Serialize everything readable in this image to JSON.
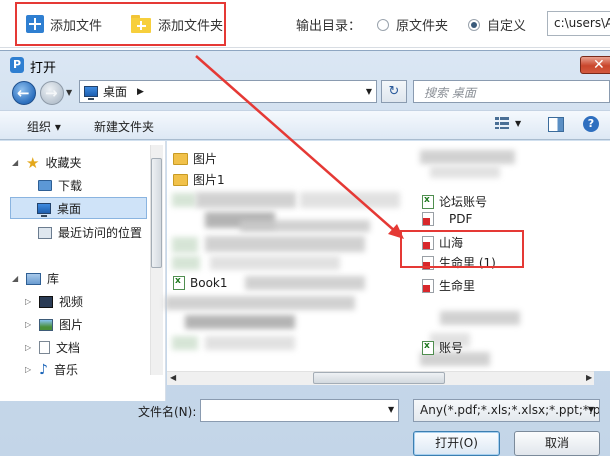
{
  "app_toolbar": {
    "add_file": "添加文件",
    "add_folder": "添加文件夹",
    "output_dir_label": "输出目录：",
    "radio_original": "原文件夹",
    "radio_custom": "自定义",
    "selected_radio": "自定义",
    "path_value": "c:\\users\\A"
  },
  "dialog": {
    "title": "打开",
    "close_symbol": "✕",
    "address": {
      "location": "桌面",
      "separator": "▶"
    },
    "search_placeholder": "搜索 桌面",
    "command_bar": {
      "organize": "组织 ▾",
      "new_folder": "新建文件夹"
    },
    "nav_pane": {
      "favorites": "收藏夹",
      "downloads": "下载",
      "desktop": "桌面",
      "recent": "最近访问的位置",
      "libraries": "库",
      "video": "视频",
      "pictures": "图片",
      "documents": "文档",
      "music": "音乐"
    },
    "files_left": [
      {
        "name": "图片",
        "icon": "folder"
      },
      {
        "name": "图片1",
        "icon": "folder"
      },
      {
        "name": "Book1",
        "icon": "xl"
      }
    ],
    "files_right": [
      {
        "name": "论坛账号",
        "icon": "xl"
      },
      {
        "name": "PDF",
        "icon": "pdf"
      },
      {
        "name": "山海",
        "icon": "pdf"
      },
      {
        "name": "生命里 (1)",
        "icon": "pdf"
      },
      {
        "name": "生命里",
        "icon": "pdf"
      },
      {
        "name": "账号",
        "icon": "xl"
      }
    ],
    "filename_label": "文件名(N):",
    "filename_value": "",
    "filetype_value": "Any(*.pdf;*.xls;*.xlsx;*.ppt;*.pp",
    "open_button": "打开(O)",
    "cancel_button": "取消"
  },
  "colors": {
    "accent_blue": "#2f7fd1",
    "folder_yellow": "#f7cf3c",
    "highlight_red": "#e53935",
    "pdf_red": "#d8272b"
  }
}
